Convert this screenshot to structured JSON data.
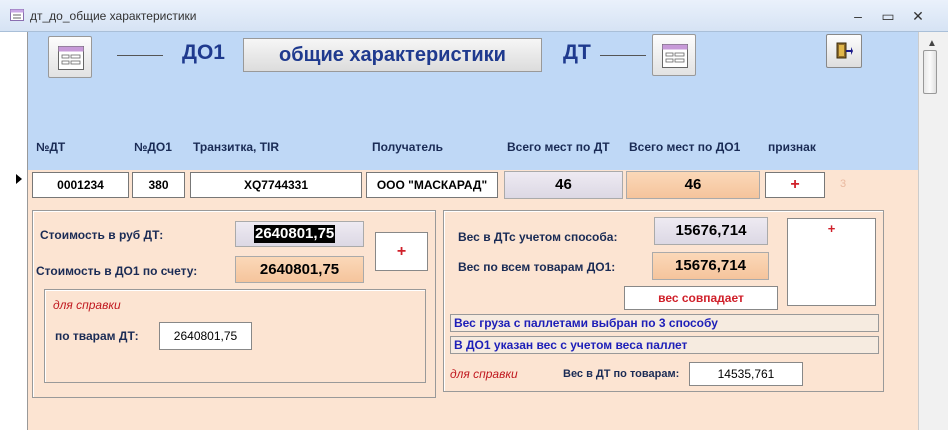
{
  "window": {
    "title": "дт_до_общие характеристики"
  },
  "header": {
    "left_label": "ДО1",
    "title": "общие характеристики",
    "right_label": "ДТ"
  },
  "columns": [
    "№ДТ",
    "№ДО1",
    "Транзитка, TIR",
    "Получатель",
    "Всего мест по ДТ",
    "Всего мест по ДО1",
    "признак"
  ],
  "row": {
    "dt_number": "0001234",
    "do1_number": "380",
    "transit_tir": "XQ7744331",
    "recipient": "ООО \"МАСКАРАД\"",
    "places_dt": "46",
    "places_do1": "46",
    "sign": "+",
    "faint_counter": "3"
  },
  "cost_panel": {
    "cost_dt_label": "Стоимость в руб ДТ:",
    "cost_dt_value": "2640801,75",
    "cost_do1_label": "Стоимость в ДО1 по счету:",
    "cost_do1_value": "2640801,75",
    "sign": "+",
    "reference_label": "для справки",
    "goods_dt_label": "по тварам ДТ:",
    "goods_dt_value": "2640801,75"
  },
  "weight_panel": {
    "weight_dt_label": "Вес в ДТс учетом способа:",
    "weight_dt_value": "15676,714",
    "weight_do1_label": "Вес по всем товарам ДО1:",
    "weight_do1_value": "15676,714",
    "status": "вес  совпадает",
    "sign": "+",
    "message1": "Вес груза с паллетами выбран по 3 способу",
    "message2": "В ДО1 указан вес с учетом веса паллет",
    "reference_label": "для справки",
    "goods_dt_label": "Вес в ДТ по товарам:",
    "goods_dt_value": "14535,761"
  },
  "colors": {
    "header_bg": "#bfd8f6",
    "form_bg": "#fce4d2",
    "title_blue": "#1f3a8e",
    "sign_red": "#d0202a"
  }
}
